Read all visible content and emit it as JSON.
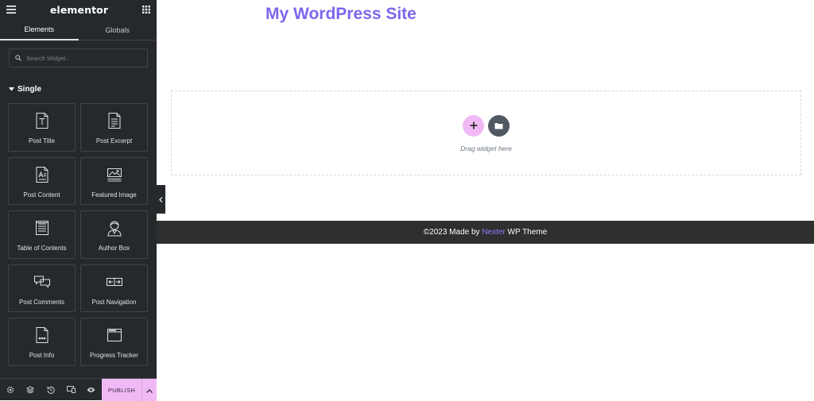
{
  "panel": {
    "logo": "elementor",
    "tabs": [
      {
        "label": "Elements",
        "active": true
      },
      {
        "label": "Globals",
        "active": false
      }
    ],
    "search": {
      "placeholder": "Search Widget..."
    },
    "section_title": "Single",
    "widgets": [
      {
        "label": "Post Title",
        "icon": "post-title-icon"
      },
      {
        "label": "Post Excerpt",
        "icon": "post-excerpt-icon"
      },
      {
        "label": "Post Content",
        "icon": "post-content-icon"
      },
      {
        "label": "Featured Image",
        "icon": "featured-image-icon"
      },
      {
        "label": "Table of Contents",
        "icon": "table-of-contents-icon"
      },
      {
        "label": "Author Box",
        "icon": "author-box-icon"
      },
      {
        "label": "Post Comments",
        "icon": "post-comments-icon"
      },
      {
        "label": "Post Navigation",
        "icon": "post-navigation-icon"
      },
      {
        "label": "Post Info",
        "icon": "post-info-icon"
      },
      {
        "label": "Progress Tracker",
        "icon": "progress-tracker-icon"
      }
    ],
    "footer": {
      "icons": [
        "settings-icon",
        "navigator-icon",
        "history-icon",
        "responsive-icon",
        "preview-icon"
      ],
      "publish_label": "PUBLISH"
    }
  },
  "canvas": {
    "site_title": "My WordPress Site",
    "drop_hint": "Drag widget here",
    "footer": {
      "prefix": "©2023 Made by ",
      "brand": "Nexter",
      "suffix": " WP Theme"
    }
  },
  "colors": {
    "panel_bg": "#26292c",
    "accent_pink": "#f0b9f5",
    "title_purple": "#7b68ee",
    "footer_bg": "#2f2f2f"
  }
}
